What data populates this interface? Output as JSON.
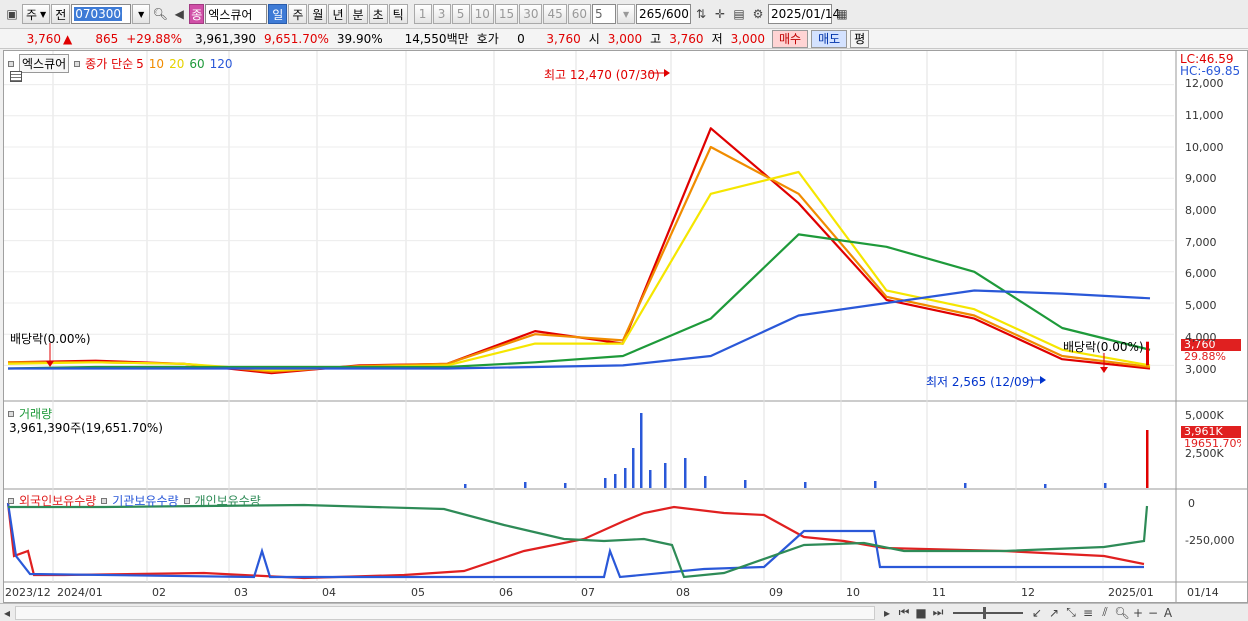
{
  "toolbar": {
    "period_mode": "주",
    "prev_label": "전",
    "stock_code": "070300",
    "stock_badge": "종",
    "stock_name": "엑스큐어",
    "periods": [
      "일",
      "주",
      "월",
      "년",
      "분",
      "초",
      "틱"
    ],
    "selected_period": "일",
    "intervals": [
      "1",
      "3",
      "5",
      "10",
      "15",
      "30",
      "45",
      "60"
    ],
    "interval_value": "5",
    "count_value": "265",
    "count_total": "/600",
    "date_value": "2025/01/14"
  },
  "quote": {
    "price": "3,760",
    "change": "865",
    "change_rate": "+29.88%",
    "volume": "3,961,390",
    "volume_rate": "9,651.70%",
    "turnover_rate": "39.90%",
    "amount": "14,550백만",
    "hoga_label": "호가",
    "hoga_value": "0",
    "hoga_price": "3,760",
    "open_label": "시",
    "open": "3,000",
    "high_label": "고",
    "high": "3,760",
    "low_label": "저",
    "low": "3,000",
    "buy_label": "매수",
    "sell_label": "매도",
    "flat_label": "평"
  },
  "price_panel": {
    "legend_name": "엑스큐어",
    "legend_series": "종가 단순",
    "legend_ma": [
      "5",
      "10",
      "20",
      "60",
      "120"
    ],
    "lc_label": "LC:46.59",
    "hc_label": "HC:-69.85",
    "high_annotation": "최고 12,470 (07/30)",
    "low_annotation": "최저 2,565 (12/09)",
    "dividend_left": "배당락(0.00%)",
    "dividend_right": "배당락(0.00%)",
    "y_ticks": [
      "12,000",
      "11,000",
      "10,000",
      "9,000",
      "8,000",
      "7,000",
      "6,000",
      "5,000",
      "4,000",
      "3,000"
    ],
    "price_tag": "3,760",
    "rate_tag": "29.88%"
  },
  "volume_panel": {
    "title": "거래량",
    "readout": "3,961,390주(19,651.70%)",
    "y_ticks": [
      "5,000K",
      "2,500K"
    ],
    "tag_volume": "3,961K",
    "tag_rate": "19651.70%"
  },
  "holding_panel": {
    "legend": [
      "외국인보유수량",
      "기관보유수량",
      "개인보유수량"
    ],
    "y_ticks": [
      "0",
      "-250,000"
    ]
  },
  "x_axis": {
    "labels": [
      "2023/12",
      "2024/01",
      "02",
      "03",
      "04",
      "05",
      "06",
      "07",
      "08",
      "09",
      "10",
      "11",
      "12",
      "2025/01",
      "01/14"
    ]
  },
  "colors": {
    "ma5": "#e00000",
    "ma10": "#f08c00",
    "ma20": "#f5e600",
    "ma60": "#1e9a3a",
    "ma120": "#2a58d8",
    "foreign": "#e02020",
    "institution": "#2a58d8",
    "individual": "#2e8b57"
  },
  "chart_data": {
    "type": "line",
    "x": [
      "2023/12",
      "2024/01",
      "02",
      "03",
      "04",
      "05",
      "06",
      "07",
      "08",
      "09",
      "10",
      "11",
      "12",
      "2025/01"
    ],
    "series": [
      {
        "name": "5",
        "values": [
          3100,
          3150,
          3050,
          2750,
          3000,
          3050,
          4100,
          3700,
          10600,
          8200,
          5100,
          4500,
          3200,
          2900
        ]
      },
      {
        "name": "10",
        "values": [
          3100,
          3100,
          3050,
          2800,
          2980,
          3050,
          4000,
          3800,
          10000,
          8500,
          5200,
          4600,
          3300,
          2950
        ]
      },
      {
        "name": "20",
        "values": [
          3050,
          3100,
          3050,
          2850,
          2950,
          3000,
          3700,
          3700,
          8500,
          9200,
          5400,
          4800,
          3500,
          3000
        ]
      },
      {
        "name": "60",
        "values": [
          2900,
          2950,
          2950,
          2950,
          2950,
          2950,
          3100,
          3300,
          4500,
          7200,
          6800,
          6000,
          4200,
          3500
        ]
      },
      {
        "name": "120",
        "values": [
          2900,
          2900,
          2900,
          2900,
          2900,
          2900,
          2950,
          3000,
          3300,
          4600,
          5000,
          5400,
          5300,
          5150
        ]
      }
    ],
    "ylim": [
      2500,
      12500
    ]
  }
}
